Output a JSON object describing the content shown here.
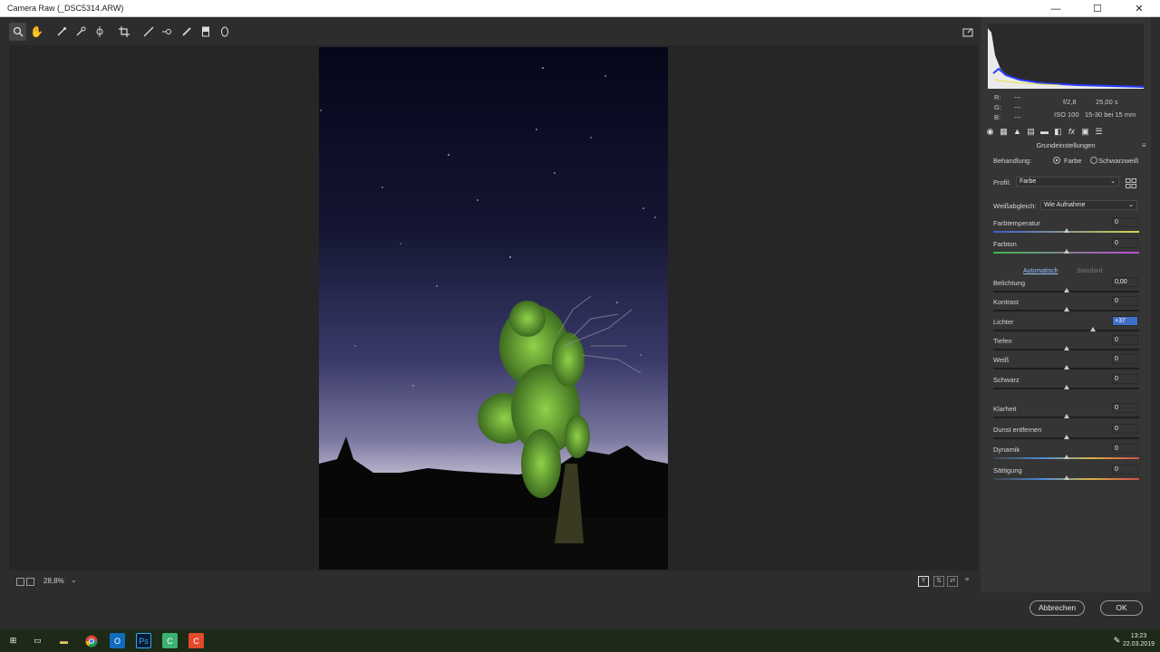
{
  "window": {
    "title": "Camera Raw (_DSC5314.ARW)",
    "minimize": "—",
    "maximize": "☐",
    "close": "✕"
  },
  "toolbar": {
    "tools": [
      "zoom-tool",
      "hand-tool",
      "white-balance-tool",
      "color-sampler-tool",
      "targeted-adjustment-tool",
      "crop-tool",
      "straighten-tool",
      "spot-removal-tool",
      "red-eye-tool",
      "adjustment-brush-tool",
      "graduated-filter-tool",
      "radial-filter-tool"
    ],
    "fullscreen_icon": "fullscreen-icon"
  },
  "preview": {
    "zoom": "28,8%"
  },
  "info": {
    "r_label": "R:",
    "g_label": "G:",
    "b_label": "B:",
    "r": "---",
    "g": "---",
    "b": "---",
    "aperture": "f/2,8",
    "shutter": "25,00 s",
    "iso": "ISO 100",
    "lens": "15-30 bei 15 mm"
  },
  "panel": {
    "title": "Grundeinstellungen",
    "behandlung_label": "Behandlung:",
    "farbe_option": "Farbe",
    "sw_option": "Schwarzweiß",
    "profil_label": "Profil:",
    "profil_value": "Farbe",
    "wb_label": "Weißabgleich:",
    "wb_value": "Wie Aufnahme",
    "auto_link": "Automatisch",
    "standard_link": "Standard"
  },
  "sliders": [
    {
      "label": "Farbtemperatur",
      "value": "0",
      "pos": 0.5
    },
    {
      "label": "Farbton",
      "value": "0",
      "pos": 0.5
    },
    {
      "label": "Belichtung",
      "value": "0,00",
      "pos": 0.5
    },
    {
      "label": "Kontrast",
      "value": "0",
      "pos": 0.5
    },
    {
      "label": "Lichter",
      "value": "+37",
      "pos": 0.685
    },
    {
      "label": "Tiefen",
      "value": "0",
      "pos": 0.5
    },
    {
      "label": "Weiß",
      "value": "0",
      "pos": 0.5
    },
    {
      "label": "Schwarz",
      "value": "0",
      "pos": 0.5
    },
    {
      "label": "Klarheit",
      "value": "0",
      "pos": 0.5
    },
    {
      "label": "Dunst entfernen",
      "value": "0",
      "pos": 0.5
    },
    {
      "label": "Dynamik",
      "value": "0",
      "pos": 0.5
    },
    {
      "label": "Sättigung",
      "value": "0",
      "pos": 0.5
    }
  ],
  "buttons": {
    "cancel": "Abbrechen",
    "ok": "OK"
  },
  "taskbar": {
    "time": "13:23",
    "date": "22.03.2019"
  },
  "colors": {
    "accent": "#3d6fc4",
    "panel": "#353535",
    "background": "#2d2d2d"
  }
}
